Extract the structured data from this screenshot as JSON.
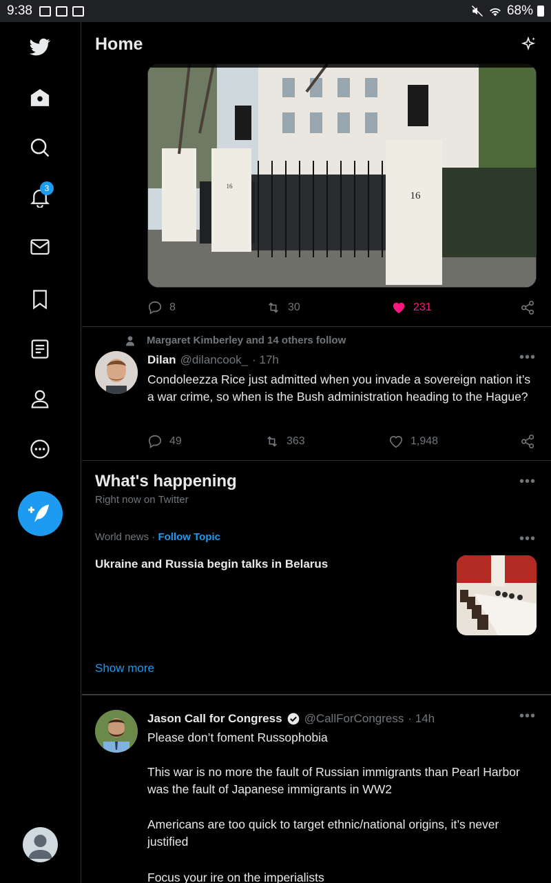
{
  "status_bar": {
    "time": "9:38",
    "battery": "68%"
  },
  "header": {
    "title": "Home"
  },
  "nav": {
    "items": [
      "twitter-logo",
      "home-icon",
      "search-icon",
      "notifications-icon",
      "messages-icon",
      "bookmarks-icon",
      "lists-icon",
      "profile-icon",
      "more-icon"
    ],
    "notification_count": "3"
  },
  "tweet1": {
    "replies": "8",
    "retweets": "30",
    "likes": "231",
    "liked": true,
    "like_color": "#f91880"
  },
  "tweet2": {
    "social_context": "Margaret Kimberley and 14 others follow",
    "name": "Dilan",
    "handle": "@dilancook_",
    "time": "· 17h",
    "text": "Condoleezza Rice just admitted when you invade a sovereign nation it’s a war crime, so when is the Bush administration heading to the Hague?",
    "replies": "49",
    "retweets": "363",
    "likes": "1,948"
  },
  "whats_happening": {
    "title": "What's happening",
    "subtitle": "Right now on Twitter",
    "trend": {
      "category": "World news",
      "separator": " · ",
      "follow_label": "Follow Topic",
      "title": "Ukraine and Russia begin talks in Belarus"
    },
    "show_more": "Show more"
  },
  "tweet3": {
    "name": "Jason Call for Congress",
    "handle": "@CallForCongress",
    "time": "· 14h",
    "text_lines": [
      "Please don’t foment Russophobia",
      "This war is no more the fault of Russian immigrants than Pearl Harbor was the fault of Japanese immigrants in WW2",
      "Americans are too quick to target ethnic/national origins, it’s never justified",
      "Focus your ire on the imperialists"
    ]
  },
  "colors": {
    "accent": "#1d9bf0",
    "muted": "#71767b",
    "text": "#e7e9ea",
    "divider": "#2f3336"
  }
}
